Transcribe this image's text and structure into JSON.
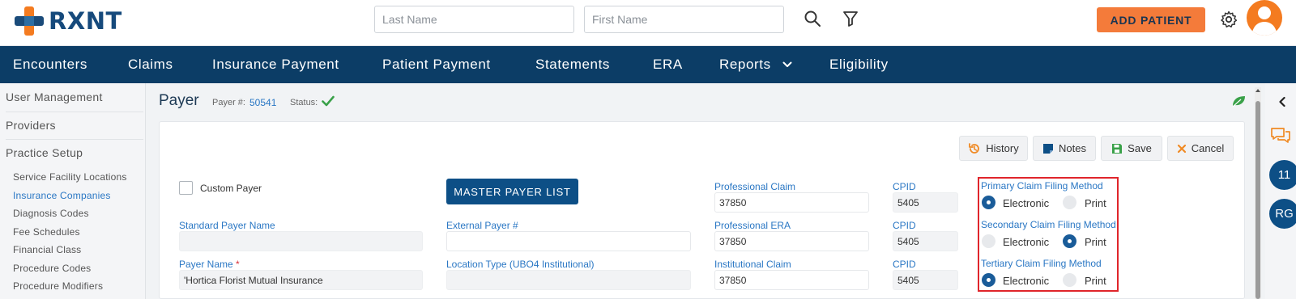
{
  "header": {
    "logo_text": "RXNT",
    "last_name_placeholder": "Last Name",
    "first_name_placeholder": "First Name",
    "add_patient_label": "ADD PATIENT"
  },
  "nav": {
    "items": [
      "Encounters",
      "Claims",
      "Insurance Payment",
      "Patient Payment",
      "Statements",
      "ERA",
      "Reports",
      "Eligibility"
    ]
  },
  "sidebar": {
    "sections": [
      "User Management",
      "Providers",
      "Practice Setup"
    ],
    "sub_items": [
      "Service Facility Locations",
      "Insurance Companies",
      "Diagnosis Codes",
      "Fee Schedules",
      "Financial Class",
      "Procedure Codes",
      "Procedure Modifiers"
    ],
    "active_sub_item": "Insurance Companies"
  },
  "page": {
    "title": "Payer",
    "payer_num_label": "Payer #:",
    "payer_num": "50541",
    "status_label": "Status:"
  },
  "toolbar": {
    "history": "History",
    "notes": "Notes",
    "save": "Save",
    "cancel": "Cancel"
  },
  "form": {
    "custom_payer_label": "Custom Payer",
    "custom_payer_checked": false,
    "master_payer_list": "MASTER PAYER LIST",
    "standard_payer_name_label": "Standard Payer Name",
    "standard_payer_name_value": "",
    "external_payer_label": "External Payer #",
    "external_payer_value": "",
    "payer_name_label": "Payer Name",
    "payer_name_required": "*",
    "payer_name_value": "'Hortica Florist Mutual Insurance",
    "location_type_label": "Location Type (UBO4 Institutional)",
    "location_type_value": "",
    "professional_claim_label": "Professional Claim",
    "professional_claim_value": "37850",
    "professional_era_label": "Professional ERA",
    "professional_era_value": "37850",
    "institutional_claim_label": "Institutional Claim",
    "institutional_claim_value": "37850",
    "cpid_label": "CPID",
    "cpid_values": [
      "5405",
      "5405",
      "5405"
    ]
  },
  "filing": {
    "primary_label": "Primary Claim Filing Method",
    "secondary_label": "Secondary Claim Filing Method",
    "tertiary_label": "Tertiary Claim Filing Method",
    "electronic_label": "Electronic",
    "print_label": "Print",
    "primary_selected": "Electronic",
    "secondary_selected": "Print",
    "tertiary_selected": "Electronic"
  },
  "right_panel": {
    "count_badge": "11",
    "user_initials": "RG"
  },
  "colors": {
    "nav_bg": "#0c3d66",
    "accent_orange": "#f47b3a",
    "link_blue": "#2a77c4",
    "primary_button": "#0d4f86",
    "highlight_border": "#e0252b"
  }
}
